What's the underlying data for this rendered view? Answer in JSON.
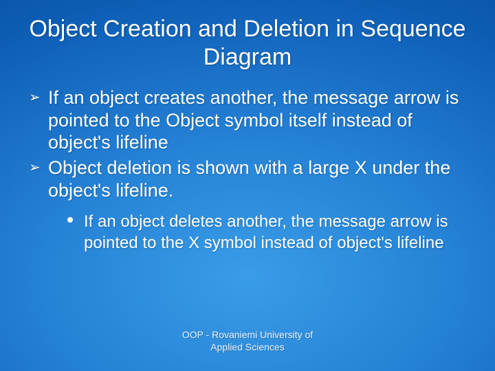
{
  "title": "Object Creation and Deletion in Sequence Diagram",
  "bullets": {
    "b1": "If an object creates another, the message arrow is pointed to the Object symbol itself instead of object's lifeline",
    "b2": "Object deletion is shown with a large X under the object's lifeline.",
    "sub1": "If an object deletes another, the message arrow is pointed to the X symbol instead of object's lifeline"
  },
  "glyphs": {
    "arrow": "➢"
  },
  "footer": {
    "line1": "OOP - Rovaniemi University of",
    "line2": "Applied Sciences"
  }
}
